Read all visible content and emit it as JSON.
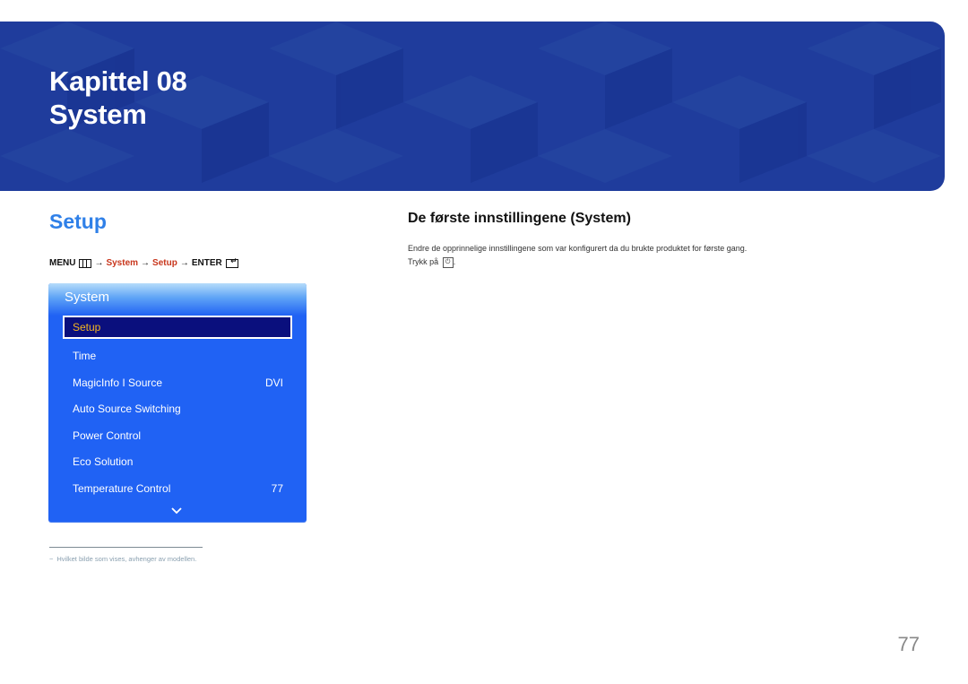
{
  "banner": {
    "chapter": "Kapittel 08",
    "title": "System",
    "color": "#1f3c9c"
  },
  "section": {
    "title": "Setup",
    "color": "#2f80e8"
  },
  "menu_path": {
    "menu_label": "MENU",
    "menu_icon": "menu-grid-icon",
    "arrow": "→",
    "step1": "System",
    "step2": "Setup",
    "enter_label": "ENTER",
    "enter_icon": "enter-icon",
    "highlight_color": "#c8361c"
  },
  "osd": {
    "title": "System",
    "items": [
      {
        "label": "Setup",
        "value": "",
        "selected": true
      },
      {
        "label": "Time",
        "value": ""
      },
      {
        "label": "MagicInfo I Source",
        "value": "DVI"
      },
      {
        "label": "Auto Source Switching",
        "value": ""
      },
      {
        "label": "Power Control",
        "value": ""
      },
      {
        "label": "Eco Solution",
        "value": ""
      },
      {
        "label": "Temperature Control",
        "value": "77"
      }
    ],
    "scroll_icon": "chevron-down-icon",
    "bg_color": "#2062f4",
    "selected_bg": "#0a0f7d",
    "selected_text_color": "#f5b51f"
  },
  "right": {
    "heading": "De første innstillingene (System)",
    "description": "Endre de opprinnelige innstillingene som var konfigurert da du brukte produktet for første gang.",
    "press_prefix": "Trykk på",
    "power_icon": "power-icon",
    "press_suffix": "."
  },
  "footnote": {
    "dash": "−",
    "text": "Hvilket bilde som vises, avhenger av modellen."
  },
  "page_number": "77"
}
